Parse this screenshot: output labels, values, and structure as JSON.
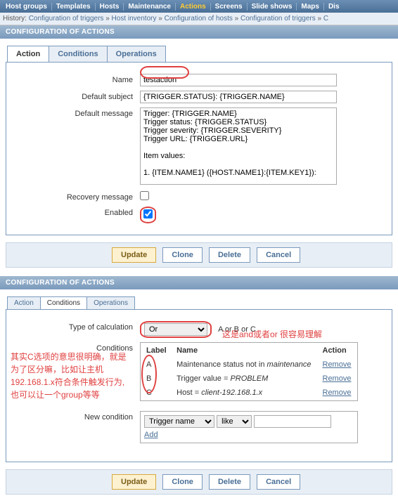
{
  "topnav": {
    "items": [
      "Host groups",
      "Templates",
      "Hosts",
      "Maintenance",
      "Actions",
      "Screens",
      "Slide shows",
      "Maps",
      "Dis"
    ],
    "active": "Actions"
  },
  "history": {
    "label": "History:",
    "crumbs": [
      "Configuration of triggers",
      "Host inventory",
      "Configuration of hosts",
      "Configuration of triggers",
      "C"
    ]
  },
  "s1": {
    "header": "CONFIGURATION OF ACTIONS",
    "tabs": {
      "action": "Action",
      "conditions": "Conditions",
      "operations": "Operations"
    },
    "labels": {
      "name": "Name",
      "default_subject": "Default subject",
      "default_message": "Default message",
      "recovery_message": "Recovery message",
      "enabled": "Enabled"
    },
    "values": {
      "name": "testaction",
      "default_subject": "{TRIGGER.STATUS}: {TRIGGER.NAME}",
      "default_message": "Trigger: {TRIGGER.NAME}\nTrigger status: {TRIGGER.STATUS}\nTrigger severity: {TRIGGER.SEVERITY}\nTrigger URL: {TRIGGER.URL}\n\nItem values:\n\n1. {ITEM.NAME1} ({HOST.NAME1}:{ITEM.KEY1}):",
      "recovery_message": false,
      "enabled": true
    },
    "buttons": {
      "update": "Update",
      "clone": "Clone",
      "delete": "Delete",
      "cancel": "Cancel"
    }
  },
  "s2": {
    "header": "CONFIGURATION OF ACTIONS",
    "tabs": {
      "action": "Action",
      "conditions": "Conditions",
      "operations": "Operations"
    },
    "labels": {
      "type_of_calculation": "Type of calculation",
      "conditions": "Conditions",
      "new_condition": "New condition"
    },
    "calc": {
      "value": "Or",
      "formula": "A or B or C"
    },
    "cond_table": {
      "headers": {
        "label": "Label",
        "name": "Name",
        "action": "Action"
      },
      "rows": [
        {
          "label": "A",
          "name_prefix": "Maintenance status not in ",
          "name_em": "maintenance",
          "action": "Remove"
        },
        {
          "label": "B",
          "name_prefix": "Trigger value = ",
          "name_em": "PROBLEM",
          "action": "Remove"
        },
        {
          "label": "C",
          "name_prefix": "Host = ",
          "name_em": "client-192.168.1.x",
          "action": "Remove"
        }
      ]
    },
    "new_cond": {
      "field": "Trigger name",
      "op": "like",
      "value": "",
      "add": "Add"
    },
    "buttons": {
      "update": "Update",
      "clone": "Clone",
      "delete": "Delete",
      "cancel": "Cancel"
    },
    "annotations": {
      "top": "这是and或者or 很容易理解",
      "left": "其实C选项的意思很明确，就是为了区分嘛，比如让主机192.168.1.x符合条件触发行为,也可以让一个group等等"
    }
  }
}
